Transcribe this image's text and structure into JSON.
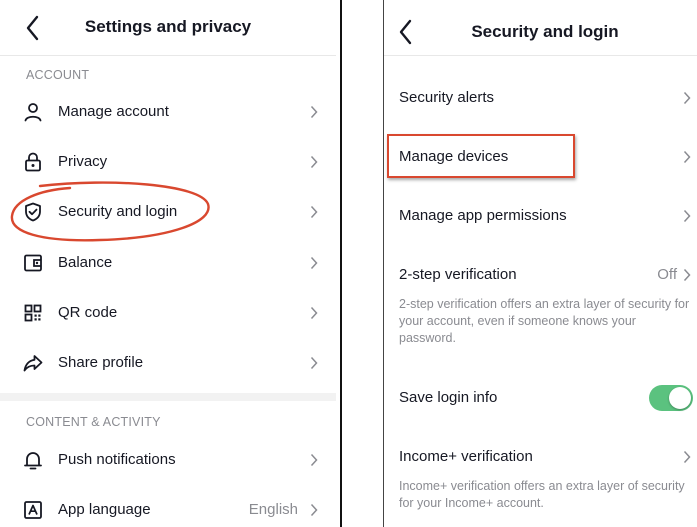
{
  "left": {
    "title": "Settings and privacy",
    "section_account": "ACCOUNT",
    "section_content": "CONTENT & ACTIVITY",
    "items": [
      {
        "label": "Manage account",
        "icon": "person-icon"
      },
      {
        "label": "Privacy",
        "icon": "lock-icon"
      },
      {
        "label": "Security and login",
        "icon": "shield-icon"
      },
      {
        "label": "Balance",
        "icon": "wallet-icon"
      },
      {
        "label": "QR code",
        "icon": "qr-code-icon"
      },
      {
        "label": "Share profile",
        "icon": "share-icon"
      }
    ],
    "content_items": [
      {
        "label": "Push notifications",
        "icon": "bell-icon"
      },
      {
        "label": "App language",
        "icon": "language-icon",
        "value": "English"
      }
    ]
  },
  "right": {
    "title": "Security and login",
    "security_alerts": "Security alerts",
    "manage_devices": "Manage devices",
    "manage_app_permissions": "Manage app permissions",
    "two_step": {
      "label": "2-step verification",
      "value": "Off",
      "description": "2-step verification offers an extra layer of security for your account, even if someone knows your password."
    },
    "save_login": {
      "label": "Save login info",
      "enabled": true
    },
    "income_verification": {
      "label": "Income+ verification",
      "description": "Income+ verification offers an extra layer of security for your Income+ account."
    }
  },
  "colors": {
    "highlight": "#d9482f",
    "toggle_on": "#5bc27f",
    "secondary_text": "#8a8b91",
    "primary_text": "#161823"
  }
}
